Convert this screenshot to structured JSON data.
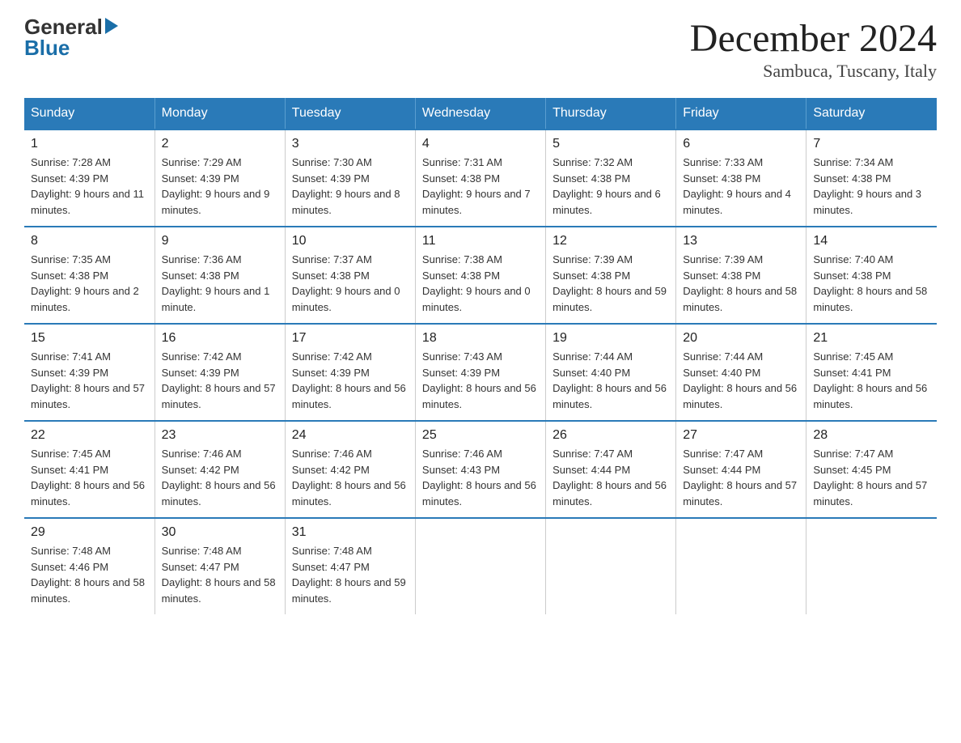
{
  "header": {
    "month_title": "December 2024",
    "location": "Sambuca, Tuscany, Italy",
    "logo_general": "General",
    "logo_blue": "Blue"
  },
  "days_of_week": [
    "Sunday",
    "Monday",
    "Tuesday",
    "Wednesday",
    "Thursday",
    "Friday",
    "Saturday"
  ],
  "weeks": [
    [
      {
        "day": "1",
        "sunrise": "7:28 AM",
        "sunset": "4:39 PM",
        "daylight": "9 hours and 11 minutes."
      },
      {
        "day": "2",
        "sunrise": "7:29 AM",
        "sunset": "4:39 PM",
        "daylight": "9 hours and 9 minutes."
      },
      {
        "day": "3",
        "sunrise": "7:30 AM",
        "sunset": "4:39 PM",
        "daylight": "9 hours and 8 minutes."
      },
      {
        "day": "4",
        "sunrise": "7:31 AM",
        "sunset": "4:38 PM",
        "daylight": "9 hours and 7 minutes."
      },
      {
        "day": "5",
        "sunrise": "7:32 AM",
        "sunset": "4:38 PM",
        "daylight": "9 hours and 6 minutes."
      },
      {
        "day": "6",
        "sunrise": "7:33 AM",
        "sunset": "4:38 PM",
        "daylight": "9 hours and 4 minutes."
      },
      {
        "day": "7",
        "sunrise": "7:34 AM",
        "sunset": "4:38 PM",
        "daylight": "9 hours and 3 minutes."
      }
    ],
    [
      {
        "day": "8",
        "sunrise": "7:35 AM",
        "sunset": "4:38 PM",
        "daylight": "9 hours and 2 minutes."
      },
      {
        "day": "9",
        "sunrise": "7:36 AM",
        "sunset": "4:38 PM",
        "daylight": "9 hours and 1 minute."
      },
      {
        "day": "10",
        "sunrise": "7:37 AM",
        "sunset": "4:38 PM",
        "daylight": "9 hours and 0 minutes."
      },
      {
        "day": "11",
        "sunrise": "7:38 AM",
        "sunset": "4:38 PM",
        "daylight": "9 hours and 0 minutes."
      },
      {
        "day": "12",
        "sunrise": "7:39 AM",
        "sunset": "4:38 PM",
        "daylight": "8 hours and 59 minutes."
      },
      {
        "day": "13",
        "sunrise": "7:39 AM",
        "sunset": "4:38 PM",
        "daylight": "8 hours and 58 minutes."
      },
      {
        "day": "14",
        "sunrise": "7:40 AM",
        "sunset": "4:38 PM",
        "daylight": "8 hours and 58 minutes."
      }
    ],
    [
      {
        "day": "15",
        "sunrise": "7:41 AM",
        "sunset": "4:39 PM",
        "daylight": "8 hours and 57 minutes."
      },
      {
        "day": "16",
        "sunrise": "7:42 AM",
        "sunset": "4:39 PM",
        "daylight": "8 hours and 57 minutes."
      },
      {
        "day": "17",
        "sunrise": "7:42 AM",
        "sunset": "4:39 PM",
        "daylight": "8 hours and 56 minutes."
      },
      {
        "day": "18",
        "sunrise": "7:43 AM",
        "sunset": "4:39 PM",
        "daylight": "8 hours and 56 minutes."
      },
      {
        "day": "19",
        "sunrise": "7:44 AM",
        "sunset": "4:40 PM",
        "daylight": "8 hours and 56 minutes."
      },
      {
        "day": "20",
        "sunrise": "7:44 AM",
        "sunset": "4:40 PM",
        "daylight": "8 hours and 56 minutes."
      },
      {
        "day": "21",
        "sunrise": "7:45 AM",
        "sunset": "4:41 PM",
        "daylight": "8 hours and 56 minutes."
      }
    ],
    [
      {
        "day": "22",
        "sunrise": "7:45 AM",
        "sunset": "4:41 PM",
        "daylight": "8 hours and 56 minutes."
      },
      {
        "day": "23",
        "sunrise": "7:46 AM",
        "sunset": "4:42 PM",
        "daylight": "8 hours and 56 minutes."
      },
      {
        "day": "24",
        "sunrise": "7:46 AM",
        "sunset": "4:42 PM",
        "daylight": "8 hours and 56 minutes."
      },
      {
        "day": "25",
        "sunrise": "7:46 AM",
        "sunset": "4:43 PM",
        "daylight": "8 hours and 56 minutes."
      },
      {
        "day": "26",
        "sunrise": "7:47 AM",
        "sunset": "4:44 PM",
        "daylight": "8 hours and 56 minutes."
      },
      {
        "day": "27",
        "sunrise": "7:47 AM",
        "sunset": "4:44 PM",
        "daylight": "8 hours and 57 minutes."
      },
      {
        "day": "28",
        "sunrise": "7:47 AM",
        "sunset": "4:45 PM",
        "daylight": "8 hours and 57 minutes."
      }
    ],
    [
      {
        "day": "29",
        "sunrise": "7:48 AM",
        "sunset": "4:46 PM",
        "daylight": "8 hours and 58 minutes."
      },
      {
        "day": "30",
        "sunrise": "7:48 AM",
        "sunset": "4:47 PM",
        "daylight": "8 hours and 58 minutes."
      },
      {
        "day": "31",
        "sunrise": "7:48 AM",
        "sunset": "4:47 PM",
        "daylight": "8 hours and 59 minutes."
      },
      null,
      null,
      null,
      null
    ]
  ],
  "labels": {
    "sunrise": "Sunrise:",
    "sunset": "Sunset:",
    "daylight": "Daylight:"
  }
}
